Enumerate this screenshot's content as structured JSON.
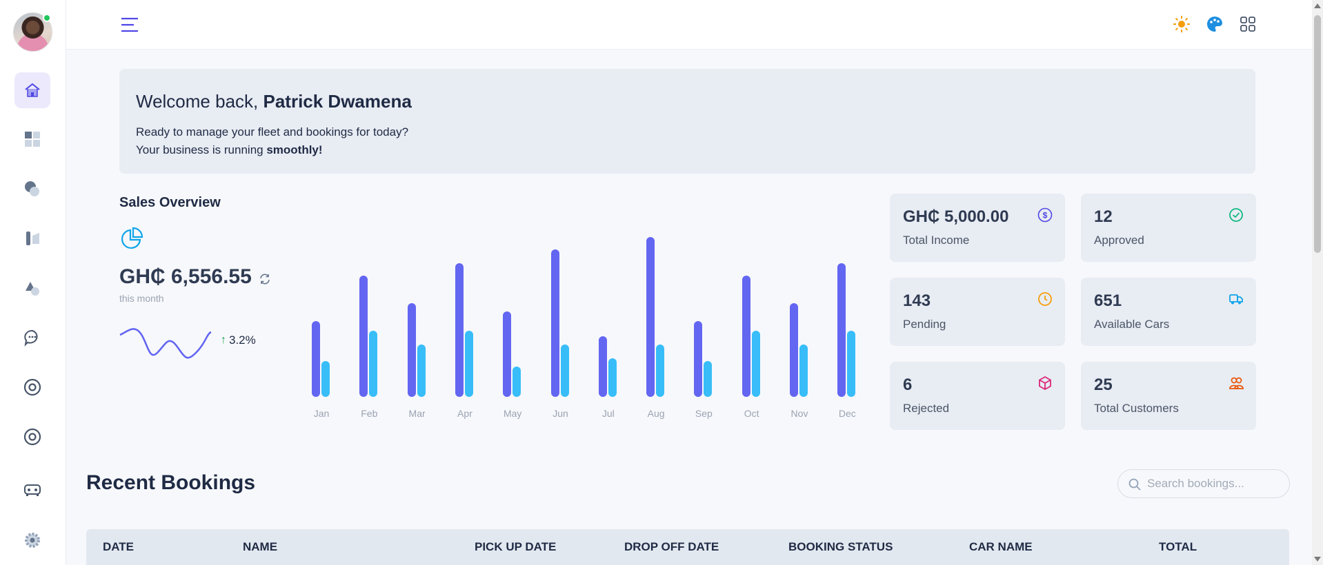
{
  "sidebar": {
    "items": [
      {
        "icon": "home-icon",
        "active": true
      },
      {
        "icon": "dashboard-grid-icon"
      },
      {
        "icon": "circles-icon"
      },
      {
        "icon": "tools-icon"
      },
      {
        "icon": "shapes-icon"
      },
      {
        "icon": "chat-icon"
      },
      {
        "icon": "target-icon"
      },
      {
        "icon": "target-icon"
      },
      {
        "icon": "car-icon"
      },
      {
        "icon": "gear-icon"
      }
    ]
  },
  "topbar": {
    "icons": [
      "menu-icon",
      "sun-icon",
      "palette-icon",
      "apps-grid-icon"
    ]
  },
  "welcome": {
    "greeting": "Welcome back, ",
    "name": "Patrick Dwamena",
    "line1": "Ready to manage your fleet and bookings for today?",
    "line2_prefix": "Your business is running ",
    "line2_bold": "smoothly!"
  },
  "sales": {
    "title": "Sales Overview",
    "value": "GH₵ 6,556.55",
    "subtitle": "this month",
    "trend": "3.2%"
  },
  "chart_data": {
    "type": "bar",
    "categories": [
      "Jan",
      "Feb",
      "Mar",
      "Apr",
      "May",
      "Jun",
      "Jul",
      "Aug",
      "Sep",
      "Oct",
      "Nov",
      "Dec"
    ],
    "series": [
      {
        "values": [
          55,
          88,
          68,
          97,
          62,
          107,
          44,
          116,
          55,
          88,
          68,
          97
        ],
        "color": "#6366f1"
      },
      {
        "values": [
          26,
          48,
          38,
          48,
          22,
          38,
          28,
          38,
          26,
          48,
          38,
          48
        ],
        "color": "#38bdf8"
      }
    ],
    "ylim": [
      0,
      120
    ],
    "grid": false
  },
  "stats": [
    {
      "value": "GH₵ 5,000.00",
      "label": "Total Income",
      "icon": "dollar-icon",
      "color": "#4f46e5"
    },
    {
      "value": "12",
      "label": "Approved",
      "icon": "check-circle-icon",
      "color": "#10b981"
    },
    {
      "value": "143",
      "label": "Pending",
      "icon": "clock-icon",
      "color": "#f59e0b"
    },
    {
      "value": "651",
      "label": "Available Cars",
      "icon": "truck-icon",
      "color": "#0ea5e9"
    },
    {
      "value": "6",
      "label": "Rejected",
      "icon": "box-icon",
      "color": "#db2777"
    },
    {
      "value": "25",
      "label": "Total Customers",
      "icon": "users-icon",
      "color": "#ea580c"
    }
  ],
  "recent": {
    "title": "Recent Bookings",
    "search_placeholder": "Search bookings...",
    "columns": [
      "DATE",
      "NAME",
      "PICK UP DATE",
      "DROP OFF DATE",
      "BOOKING STATUS",
      "CAR NAME",
      "TOTAL"
    ]
  }
}
